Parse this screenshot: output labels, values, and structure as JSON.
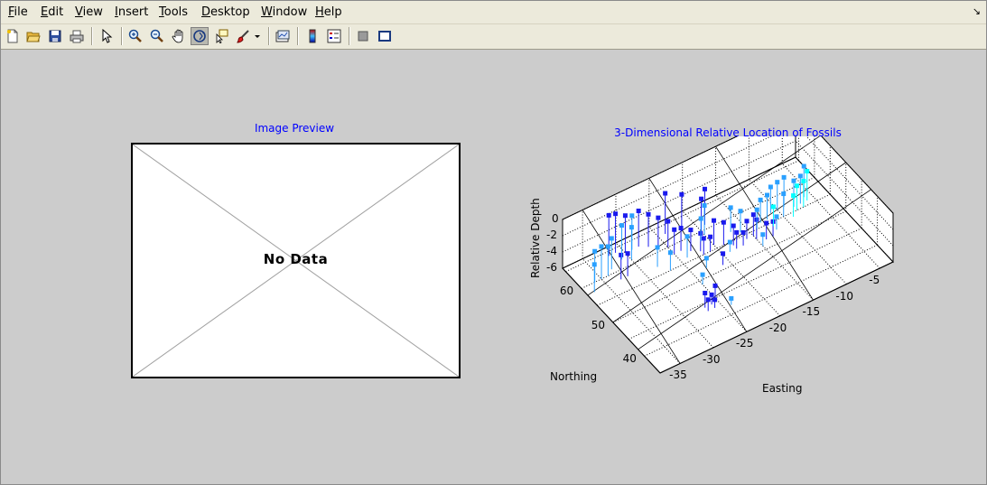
{
  "menubar": {
    "items": [
      "File",
      "Edit",
      "View",
      "Insert",
      "Tools",
      "Desktop",
      "Window",
      "Help"
    ],
    "mnemonics": [
      "F",
      "E",
      "V",
      "I",
      "T",
      "D",
      "W",
      "H"
    ]
  },
  "toolbar": {
    "buttons": [
      "new-file-icon",
      "open-folder-icon",
      "save-icon",
      "print-icon",
      "pointer-icon",
      "zoom-in-icon",
      "zoom-out-icon",
      "pan-hand-icon",
      "rotate-3d-icon",
      "data-cursor-icon",
      "brush-icon",
      "link-plot-icon",
      "colorbar-icon",
      "legend-icon",
      "hide-plot-tools-icon",
      "show-plot-tools-icon"
    ]
  },
  "preview": {
    "title": "Image Preview",
    "message": "No Data"
  },
  "plot": {
    "title": "3-Dimensional Relative Location of Fossils",
    "zlabel": "Relative Depth",
    "ylabel": "Northing",
    "xlabel": "Easting",
    "zticks": [
      "0",
      "-2",
      "-4",
      "-6"
    ],
    "yticks": [
      "60",
      "50",
      "40"
    ],
    "xticks": [
      "-35",
      "-30",
      "-25",
      "-20",
      "-15",
      "-10",
      "-5"
    ],
    "colors": {
      "dark": "#1a1aee",
      "light": "#2aa0ff",
      "cyan": "#00ffff"
    }
  },
  "chart_data": {
    "type": "scatter",
    "title": "3-Dimensional Relative Location of Fossils",
    "xlabel": "Easting",
    "ylabel": "Northing",
    "zlabel": "Relative Depth",
    "xlim": [
      -38,
      -3
    ],
    "ylim": [
      35,
      66
    ],
    "zlim": [
      -6,
      0
    ],
    "grid": true,
    "series": [
      {
        "color": "#1a1aee",
        "points": [
          [
            -32,
            64,
            -1
          ],
          [
            -31,
            64,
            -1.2
          ],
          [
            -30,
            63,
            -1.4
          ],
          [
            -28,
            63,
            -1.6
          ],
          [
            -27,
            62,
            -2
          ],
          [
            -26,
            61,
            -2.4
          ],
          [
            -25,
            60,
            -2.8
          ],
          [
            -25,
            58,
            -3
          ],
          [
            -24,
            58,
            -3.2
          ],
          [
            -23,
            57,
            -3.4
          ],
          [
            -22,
            56,
            -3.8
          ],
          [
            -22,
            55,
            -4
          ],
          [
            -21,
            55,
            -4.2
          ],
          [
            -20,
            56,
            -3
          ],
          [
            -19,
            55,
            -3.2
          ],
          [
            -18,
            54,
            -3.6
          ],
          [
            -18,
            53,
            -4
          ],
          [
            -17,
            53,
            -4.4
          ],
          [
            -16,
            54,
            -3.8
          ],
          [
            -15,
            54,
            -3.4
          ],
          [
            -15,
            53,
            -3.6
          ],
          [
            -14,
            52,
            -4
          ],
          [
            -13,
            52,
            -4.2
          ],
          [
            -20,
            60,
            -2
          ],
          [
            -19,
            61,
            -1.6
          ],
          [
            -21,
            51,
            -4.6
          ],
          [
            -27,
            44,
            -4.2
          ],
          [
            -27,
            43,
            -4.6
          ],
          [
            -26,
            43,
            -5
          ],
          [
            -26,
            44,
            -4.8
          ],
          [
            -25,
            45,
            -4.5
          ],
          [
            -33,
            58,
            -3
          ],
          [
            -32,
            58,
            -3.2
          ],
          [
            -24,
            63,
            -1
          ],
          [
            -22,
            62,
            -1.5
          ]
        ]
      },
      {
        "color": "#2aa0ff",
        "points": [
          [
            -35,
            60,
            -2
          ],
          [
            -36,
            60,
            -2.2
          ],
          [
            -37,
            58,
            -2.6
          ],
          [
            -34,
            60,
            -2.4
          ],
          [
            -33,
            61,
            -2.2
          ],
          [
            -31,
            62,
            -1.8
          ],
          [
            -29,
            63,
            -1.8
          ],
          [
            -28,
            57,
            -3.6
          ],
          [
            -27,
            55,
            -3.8
          ],
          [
            -24,
            56,
            -3.4
          ],
          [
            -21,
            58,
            -3.2
          ],
          [
            -20,
            59,
            -2.4
          ],
          [
            -17,
            57,
            -3
          ],
          [
            -16,
            56,
            -3.4
          ],
          [
            -14,
            55,
            -3.6
          ],
          [
            -13,
            56,
            -3.2
          ],
          [
            -12,
            56,
            -3
          ],
          [
            -11,
            57,
            -2.8
          ],
          [
            -10,
            57,
            -2.6
          ],
          [
            -9,
            57,
            -2.4
          ],
          [
            -8,
            56,
            -2.8
          ],
          [
            -7,
            56,
            -2.6
          ],
          [
            -6,
            57,
            -2.2
          ],
          [
            -19,
            53,
            -4.8
          ],
          [
            -23,
            52,
            -4.8
          ],
          [
            -15,
            51,
            -4.6
          ],
          [
            -12,
            53,
            -4.4
          ],
          [
            -25,
            49,
            -4.8
          ],
          [
            -24,
            42,
            -5.2
          ],
          [
            -30,
            61,
            -2
          ],
          [
            -10,
            55,
            -3.2
          ]
        ]
      },
      {
        "color": "#00ffff",
        "points": [
          [
            -8,
            55,
            -3
          ],
          [
            -6,
            56,
            -2.4
          ],
          [
            -9,
            54,
            -3.4
          ],
          [
            -12,
            54,
            -3.6
          ],
          [
            -7,
            55,
            -2.8
          ]
        ]
      }
    ]
  }
}
